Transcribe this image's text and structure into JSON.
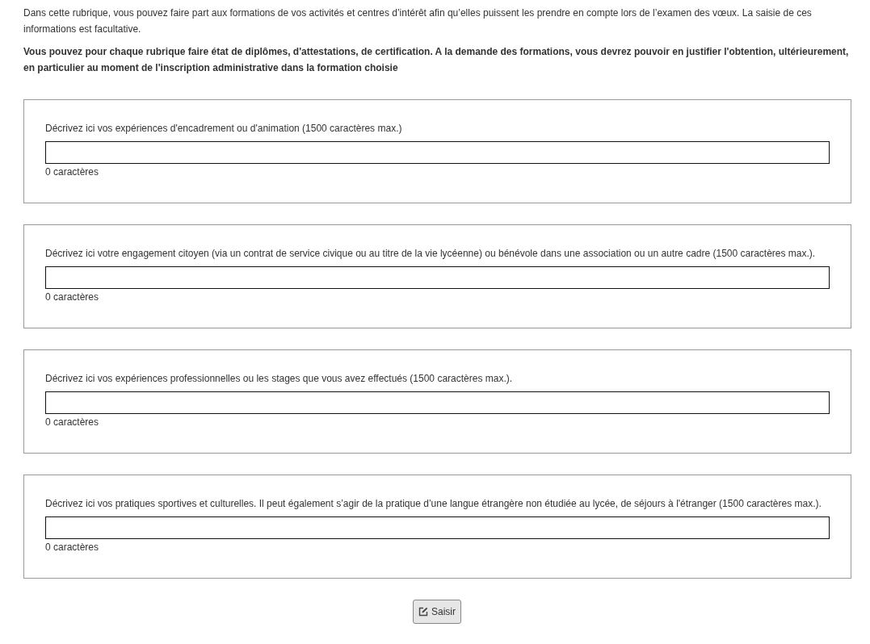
{
  "intro": "Dans cette rubrique, vous pouvez faire part aux formations de vos activités et centres d’intérêt afin qu’elles puissent les prendre en compte lors de l’examen des vœux. La saisie de ces informations est facultative.",
  "notice": "Vous pouvez pour chaque rubrique faire état de diplômes, d'attestations, de certification. A la demande des formations, vous devrez pouvoir en justifier l'obtention, ultérieurement, en particulier au moment de l'inscription administrative dans la formation choisie",
  "sections": [
    {
      "label": "Décrivez ici vos expériences d'encadrement ou d'animation (1500 caractères max.)",
      "counter": "0 caractères"
    },
    {
      "label": "Décrivez ici votre engagement citoyen (via un contrat de service civique ou au titre de la vie lycéenne) ou bénévole dans une association ou un autre cadre (1500 caractères max.).",
      "counter": "0 caractères"
    },
    {
      "label": "Décrivez ici vos expériences professionnelles ou les stages que vous avez effectués (1500 caractères max.).",
      "counter": "0 caractères"
    },
    {
      "label": "Décrivez ici vos pratiques sportives et culturelles. Il peut également s’agir de la pratique d’une langue étrangère non étudiée au lycée, de séjours à l'étranger (1500 caractères max.).",
      "counter": "0 caractères"
    }
  ],
  "submit_button": "Saisir"
}
